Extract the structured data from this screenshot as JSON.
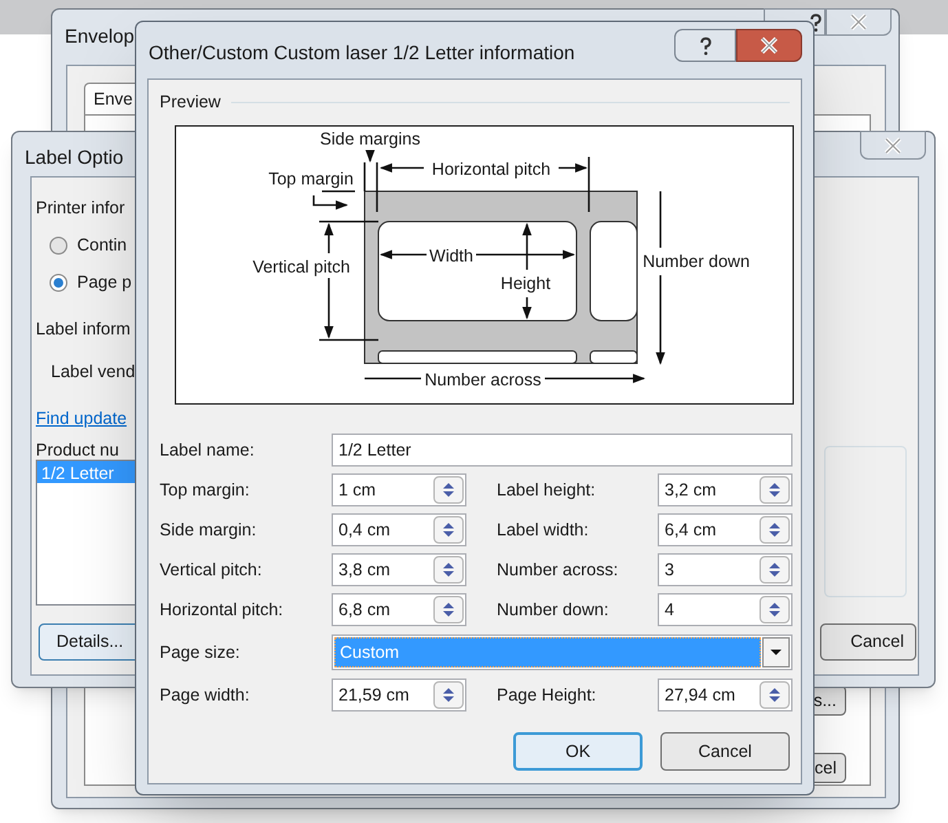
{
  "envelopes_window": {
    "title": "Envelop",
    "tabs": [
      {
        "label": "Enve",
        "selected": true
      }
    ],
    "buttons": [
      "s...",
      "cel"
    ]
  },
  "label_options_window": {
    "title": "Label Optio",
    "printer_information": "Printer infor",
    "printer_types": [
      {
        "label": "Contin",
        "selected": false
      },
      {
        "label": "Page p",
        "selected": true
      }
    ],
    "label_information": "Label inform",
    "label_vendors": "Label vend",
    "link": "Find update",
    "product_number": "Product nu",
    "products": [
      {
        "label": "1/2 Letter",
        "selected": true
      }
    ],
    "details_button": "Details...",
    "cancel_button": "Cancel"
  },
  "dialog": {
    "title": "Other/Custom Custom laser 1/2 Letter information",
    "preview_group": "Preview",
    "diagram_labels": [
      "Side margins",
      "Top margin",
      "Horizontal pitch",
      "Vertical pitch",
      "Width",
      "Height",
      "Number down",
      "Number across"
    ],
    "rows": [
      {
        "kind": "text",
        "label": "Label name:",
        "value": "1/2 Letter"
      },
      {
        "kind": "pair",
        "items": [
          {
            "label": "Top margin:",
            "value": "1 cm"
          },
          {
            "label": "Label height:",
            "value": "3,2 cm"
          }
        ]
      },
      {
        "kind": "pair",
        "items": [
          {
            "label": "Side margin:",
            "value": "0,4 cm"
          },
          {
            "label": "Label width:",
            "value": "6,4 cm"
          }
        ]
      },
      {
        "kind": "pair",
        "items": [
          {
            "label": "Vertical pitch:",
            "value": "3,8 cm"
          },
          {
            "label": "Number across:",
            "value": "3"
          }
        ]
      },
      {
        "kind": "pair",
        "items": [
          {
            "label": "Horizontal pitch:",
            "value": "6,8 cm"
          },
          {
            "label": "Number down:",
            "value": "4"
          }
        ]
      },
      {
        "kind": "dropdown",
        "label": "Page size:",
        "value": "Custom",
        "highlighted": true
      },
      {
        "kind": "pair",
        "items": [
          {
            "label": "Page width:",
            "value": "21,59 cm"
          },
          {
            "label": "Page Height:",
            "value": "27,94 cm"
          }
        ]
      }
    ],
    "buttons": [
      {
        "label": "OK",
        "default": true
      },
      {
        "label": "Cancel",
        "default": false
      }
    ]
  }
}
